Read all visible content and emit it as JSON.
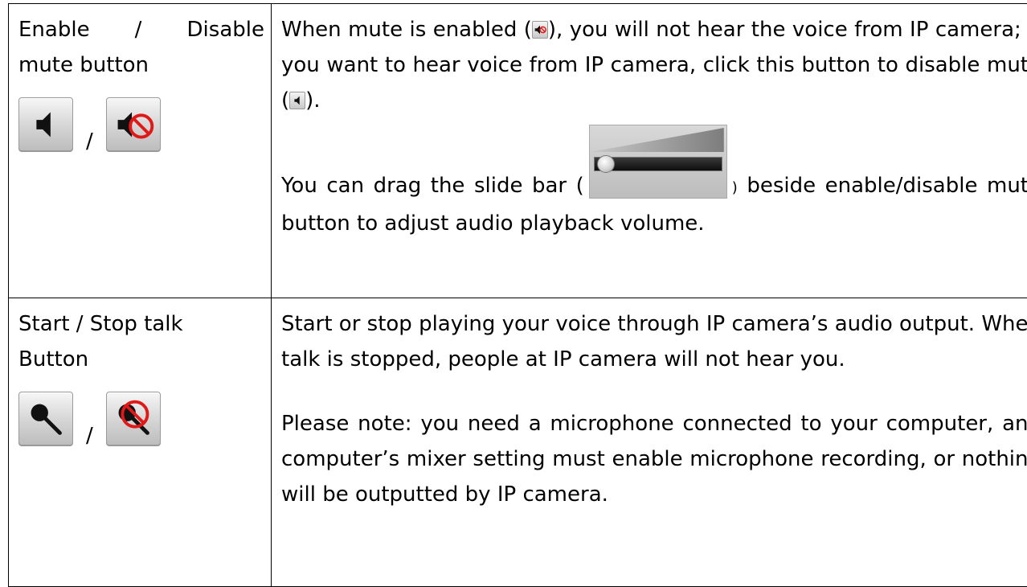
{
  "rows": [
    {
      "title_line1": "Enable / Disable",
      "title_line2": "mute button",
      "separator": "/",
      "icons": [
        "speaker-icon",
        "speaker-muted-icon"
      ],
      "desc": {
        "p1_a": "When mute is enabled (",
        "p1_b": "), you will not hear the voice from IP camera; If you want to hear voice from IP camera, click this button to disable mute (",
        "p1_c": ").",
        "p2_a": "You can drag the slide bar (",
        "p2_paren_close": ")",
        "p2_b": " beside enable/disable mute button to adjust audio playback volume."
      },
      "volume_level": 0.0
    },
    {
      "title_line1": "Start / Stop talk",
      "title_line2": "Button",
      "separator": "/",
      "icons": [
        "microphone-icon",
        "microphone-muted-icon"
      ],
      "desc": {
        "p1": "Start or stop playing your voice through IP camera’s audio output. When talk is stopped, people at IP camera will not hear you.",
        "p2": "Please note: you need a microphone connected to your computer, and computer’s mixer setting must enable microphone recording, or nothing will be outputted by IP camera."
      }
    }
  ],
  "colors": {
    "prohibit_red": "#e01818",
    "border": "#000000"
  }
}
